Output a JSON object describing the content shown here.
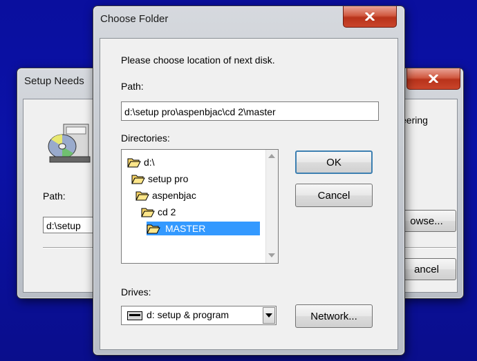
{
  "background_window": {
    "title": "Setup Needs",
    "path_label": "Path:",
    "path_value": "d:\\setup",
    "right_text": "eering",
    "browse_label": "owse...",
    "cancel_label": "ancel",
    "icon": "setup-disk-icon"
  },
  "dialog": {
    "title": "Choose Folder",
    "close_icon": "close-icon",
    "prompt": "Please choose location of next disk.",
    "path_label": "Path:",
    "path_value": "d:\\setup pro\\aspenbjac\\cd 2\\master",
    "directories_label": "Directories:",
    "directories": [
      {
        "label": "d:\\",
        "icon": "open-folder-icon",
        "selected": false
      },
      {
        "label": "setup pro",
        "icon": "open-folder-icon",
        "selected": false
      },
      {
        "label": "aspenbjac",
        "icon": "open-folder-icon",
        "selected": false
      },
      {
        "label": "cd 2",
        "icon": "open-folder-icon",
        "selected": false
      },
      {
        "label": "MASTER",
        "icon": "open-folder-icon",
        "selected": true
      }
    ],
    "drives_label": "Drives:",
    "drive_value": "d: setup & program",
    "drive_icon": "drive-icon",
    "ok_label": "OK",
    "cancel_label": "Cancel",
    "network_label": "Network..."
  },
  "colors": {
    "desktop": "#0b12a8",
    "selection": "#3399ff",
    "close_button": "#c9452b"
  }
}
